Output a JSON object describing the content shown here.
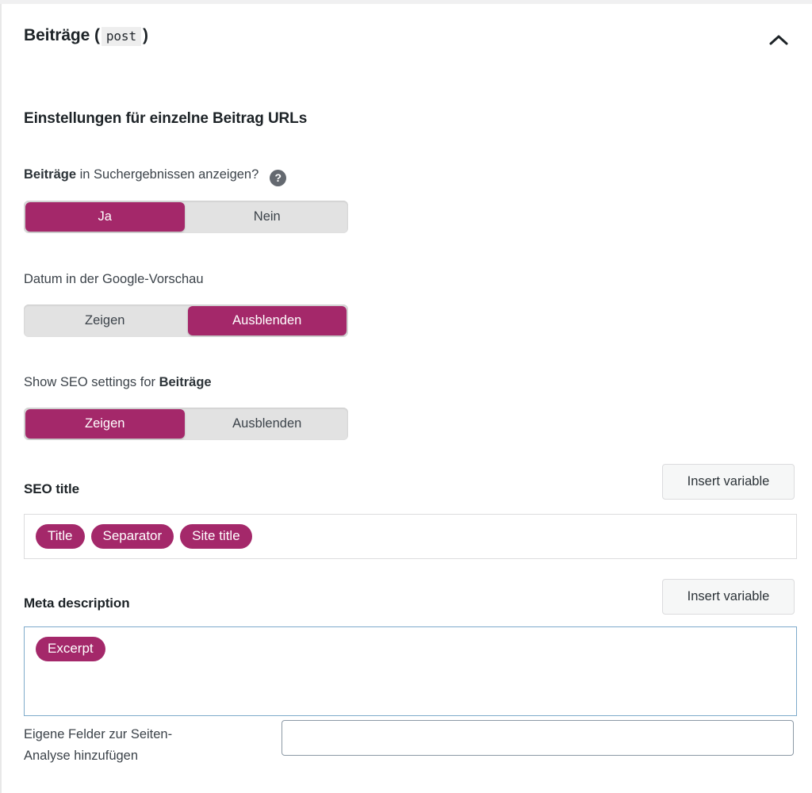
{
  "panel": {
    "title_main": "Beiträge (",
    "title_code": "post",
    "title_close": ")",
    "collapse_icon": "chevron-up-icon",
    "accent_color": "#a4286a",
    "focus_border_color": "#7eaacb"
  },
  "section": {
    "heading": "Einstellungen für einzelne Beitrag URLs"
  },
  "fields": {
    "search_results": {
      "label_strong": "Beiträge",
      "label_rest": " in Suchergebnissen anzeigen?",
      "help_icon": "?",
      "options": [
        "Ja",
        "Nein"
      ],
      "selected": "Ja"
    },
    "date_in_preview": {
      "label": "Datum in der Google-Vorschau",
      "options": [
        "Zeigen",
        "Ausblenden"
      ],
      "selected": "Ausblenden"
    },
    "show_seo_settings": {
      "label_rest": "Show SEO settings for ",
      "label_strong": "Beiträge",
      "options": [
        "Zeigen",
        "Ausblenden"
      ],
      "selected": "Zeigen"
    },
    "seo_title": {
      "title": "SEO title",
      "insert_variable_label": "Insert variable",
      "tokens": [
        "Title",
        "Separator",
        "Site title"
      ]
    },
    "meta_description": {
      "title": "Meta description",
      "insert_variable_label": "Insert variable",
      "tokens": [
        "Excerpt"
      ]
    },
    "custom_fields": {
      "label_line1": "Eigene Felder zur Seiten-",
      "label_line2": "Analyse hinzufügen",
      "value": "",
      "placeholder": ""
    }
  }
}
